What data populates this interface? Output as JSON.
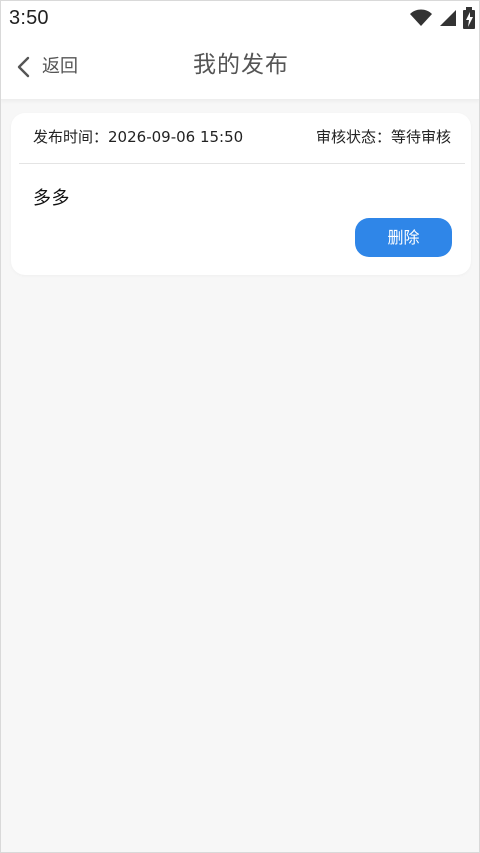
{
  "status_bar": {
    "time": "3:50",
    "icons": [
      "wifi-icon",
      "cellular-signal-icon",
      "battery-charging-icon"
    ]
  },
  "header": {
    "back_label": "返回",
    "title": "我的发布"
  },
  "post": {
    "publish_time_label": "发布时间：",
    "publish_time": "2026-09-06 15:50",
    "audit_status_label": "审核状态：",
    "audit_status": "等待审核",
    "content": "多多",
    "delete_label": "删除"
  },
  "colors": {
    "page_background": "#f7f7f7",
    "card_background": "#ffffff",
    "delete_button": "#2f86e8",
    "text_primary": "#222222",
    "title_text": "#555555"
  }
}
